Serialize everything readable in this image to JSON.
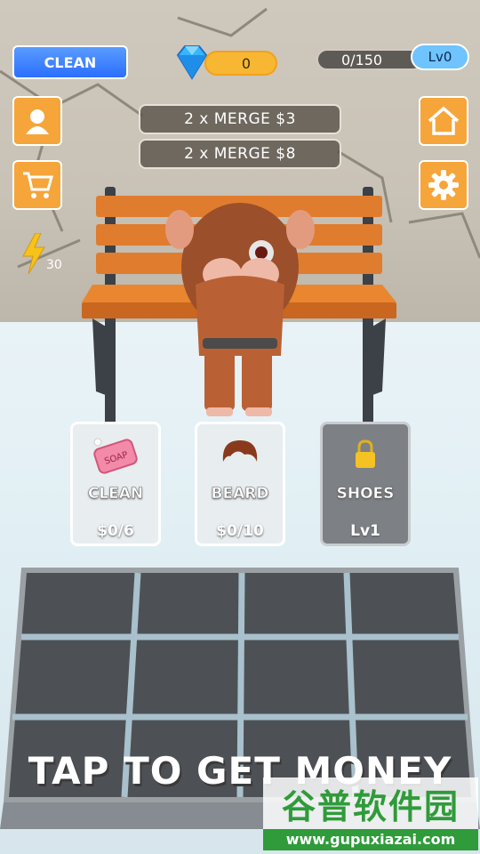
{
  "hud": {
    "clean_button": "CLEAN",
    "gems": "0",
    "progress": "0/150",
    "level": "Lv0",
    "energy": "30"
  },
  "merges": [
    {
      "label": "2 x MERGE $3"
    },
    {
      "label": "2 x MERGE $8"
    }
  ],
  "cards": [
    {
      "name": "CLEAN",
      "value": "$0/6",
      "icon": "soap-icon",
      "icon_text": "SOAP"
    },
    {
      "name": "BEARD",
      "value": "$0/10",
      "icon": "hair-icon"
    },
    {
      "name": "SHOES",
      "value": "Lv1",
      "icon": "lock-icon",
      "locked": true
    }
  ],
  "tap_prompt": "TAP TO GET MONEY",
  "watermark": {
    "title": "谷普软件园",
    "url": "www.gupuxiazai.com"
  },
  "colors": {
    "accent_orange": "#f6a53a",
    "clean_blue": "#2b6fff",
    "gem_gold": "#f7b733",
    "level_blue": "#6fc4ff"
  }
}
